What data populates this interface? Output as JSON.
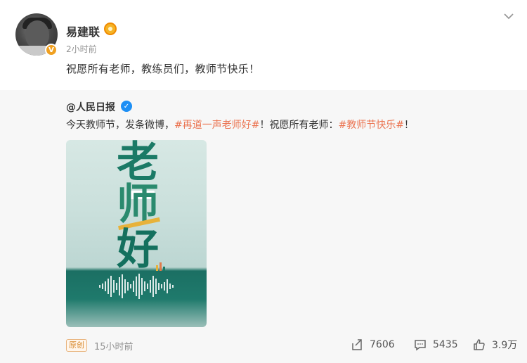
{
  "post": {
    "author": "易建联",
    "time": "2小时前",
    "text": "祝愿所有老师，教练员们，教师节快乐！",
    "avatar_badge": "V"
  },
  "repost": {
    "author": "@人民日报",
    "text_parts": {
      "pre": "今天教师节，发条微博，",
      "tag1": "#再道一声老师好#",
      "mid": "！祝愿所有老师：",
      "tag2": "#教师节快乐#",
      "post": "！"
    },
    "poster_chars": [
      "老",
      "师",
      "好"
    ],
    "badge": "原创",
    "time": "15小时前"
  },
  "actions": {
    "share_count": "7606",
    "comment_count": "5435",
    "like_count": "3.9万"
  },
  "colors": {
    "tag": "#eb7350",
    "verified_blue": "#1d8ff5",
    "poster_green": "#1b7a66"
  },
  "icons": [
    "medal-icon",
    "chevron-down-icon",
    "verified-icon",
    "share-icon",
    "comment-icon",
    "like-icon"
  ]
}
